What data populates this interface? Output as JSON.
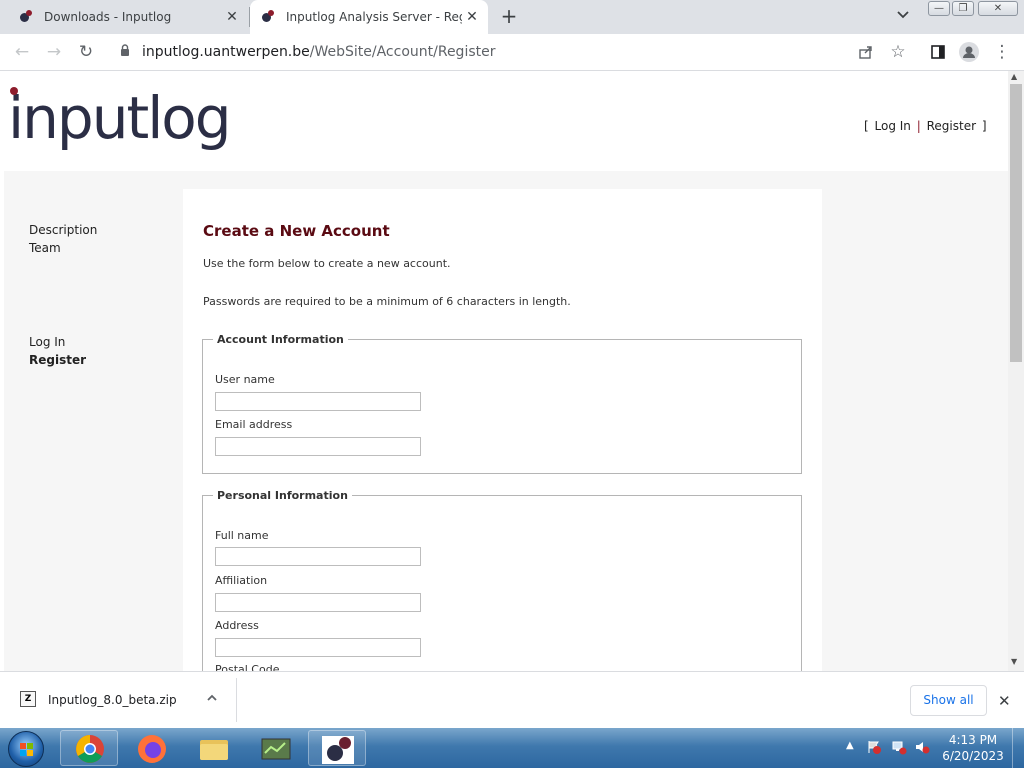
{
  "browser": {
    "tabs": [
      {
        "title": "Downloads - Inputlog"
      },
      {
        "title": "Inputlog Analysis Server - Registi"
      }
    ],
    "new_tab_glyph": "+",
    "close_glyph": "✕",
    "url_host": "inputlog.uantwerpen.be",
    "url_path": "/WebSite/Account/Register"
  },
  "header": {
    "logo_text": "inputlog",
    "login_open": "[",
    "login_link": "Log In",
    "login_sep": "|",
    "register_link": "Register",
    "login_close": "]"
  },
  "sidebar": {
    "nav_top": [
      {
        "label": "Description"
      },
      {
        "label": "Team"
      }
    ],
    "nav_bottom": [
      {
        "label": "Log In"
      },
      {
        "label": "Register"
      }
    ]
  },
  "form": {
    "heading": "Create a New Account",
    "intro": "Use the form below to create a new account.",
    "password_note": "Passwords are required to be a minimum of 6 characters in length.",
    "account_legend": "Account Information",
    "username_label": "User name",
    "username_value": "",
    "email_label": "Email address",
    "email_value": "",
    "personal_legend": "Personal Information",
    "fullname_label": "Full name",
    "fullname_value": "",
    "affiliation_label": "Affiliation",
    "affiliation_value": "",
    "address_label": "Address",
    "address_value": "",
    "postal_label": "Postal Code"
  },
  "downloads": {
    "file_name": "Inputlog_8.0_beta.zip",
    "show_all": "Show all"
  },
  "taskbar": {
    "time": "4:13 PM",
    "date": "6/20/2023"
  },
  "colors": {
    "heading": "#5a0a12",
    "logo": "#2b2e45",
    "logo_dot": "#8d1c2c",
    "link_blue": "#1a73e8"
  }
}
